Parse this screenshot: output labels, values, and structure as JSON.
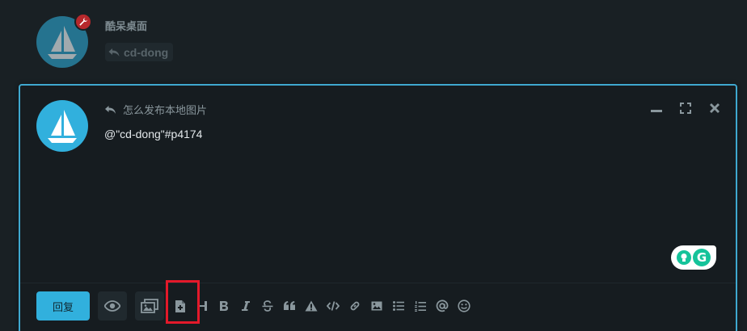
{
  "post": {
    "username": "酷呆桌面",
    "reply_to": "cd-dong",
    "badge_icon": "wrench-icon"
  },
  "composer": {
    "title": "怎么发布本地图片",
    "content": "@\"cd-dong\"#p4174",
    "reply_button": "回复",
    "grammarly_letter": "G"
  },
  "colors": {
    "accent": "#31b0dd",
    "background": "#192024",
    "badge": "#b7282c",
    "highlight": "#e3192a",
    "grammarly": "#15c39a"
  },
  "toolbar": {
    "tools": [
      "preview-eye-icon",
      "image-upload-icon",
      "file-upload-icon",
      "heading-icon",
      "bold-icon",
      "italic-icon",
      "strikethrough-icon",
      "quote-icon",
      "warning-icon",
      "code-icon",
      "link-icon",
      "image-icon",
      "bullet-list-icon",
      "ordered-list-icon",
      "mention-icon",
      "emoji-icon"
    ]
  }
}
